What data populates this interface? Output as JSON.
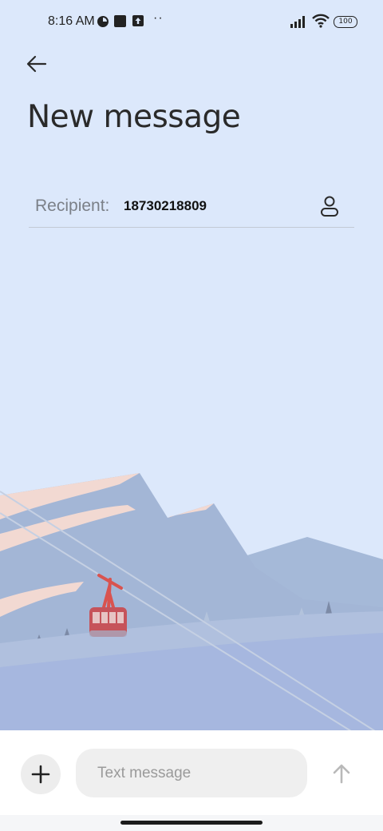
{
  "status_bar": {
    "time": "8:16 AM",
    "dots": "··",
    "battery": "100",
    "icons": [
      "notification-icon",
      "stop-icon",
      "upload-icon",
      "signal-icon",
      "wifi-icon",
      "battery-icon"
    ]
  },
  "header": {
    "back_icon": "arrow-left-icon",
    "title": "New message"
  },
  "recipient": {
    "label": "Recipient:",
    "value": "18730218809",
    "contact_icon": "person-icon"
  },
  "composer": {
    "add_icon": "plus-icon",
    "placeholder": "Text message",
    "send_icon": "arrow-up-icon"
  },
  "colors": {
    "background": "#dce8fb",
    "composer_background": "#ffffff",
    "gondola": "#d9534f"
  }
}
